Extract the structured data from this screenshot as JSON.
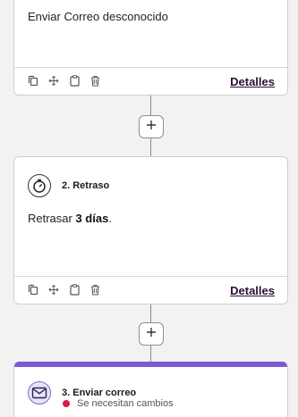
{
  "steps": [
    {
      "body_text": "Enviar Correo desconocido",
      "details_label": "Detalles",
      "toolbar": [
        "copy-icon",
        "move-icon",
        "clipboard-icon",
        "trash-icon"
      ]
    },
    {
      "title": "2. Retraso",
      "icon": "stopwatch-icon",
      "body_prefix": "Retrasar ",
      "body_bold": "3 días",
      "body_suffix": ".",
      "details_label": "Detalles",
      "toolbar": [
        "copy-icon",
        "move-icon",
        "clipboard-icon",
        "trash-icon"
      ]
    },
    {
      "title": "3. Enviar correo",
      "icon": "envelope-icon",
      "status_text": "Se necesitan cambios"
    }
  ],
  "add_step_symbol": "+",
  "colors": {
    "accent": "#7b5ad6",
    "status_dot": "#d81b4a",
    "link": "#2a1036",
    "background": "#f2f2f2"
  }
}
